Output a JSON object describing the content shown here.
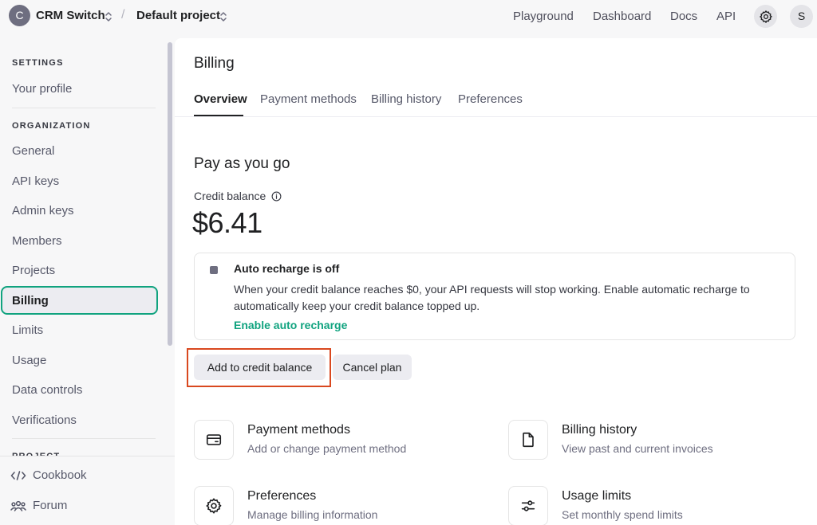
{
  "topbar": {
    "org_initial": "C",
    "org_name": "CRM Switch",
    "separator": "/",
    "project_name": "Default project",
    "nav": [
      "Playground",
      "Dashboard",
      "Docs",
      "API"
    ],
    "user_initial": "S"
  },
  "sidebar": {
    "settings_heading": "SETTINGS",
    "your_profile": "Your profile",
    "organization_heading": "ORGANIZATION",
    "items": [
      "General",
      "API keys",
      "Admin keys",
      "Members",
      "Projects",
      "Billing",
      "Limits",
      "Usage",
      "Data controls",
      "Verifications"
    ],
    "active_item": "Billing",
    "project_heading": "PROJECT",
    "footer": [
      "Cookbook",
      "Forum"
    ]
  },
  "main": {
    "title": "Billing",
    "tabs": [
      "Overview",
      "Payment methods",
      "Billing history",
      "Preferences"
    ],
    "active_tab": "Overview",
    "section_title": "Pay as you go",
    "credit_label": "Credit balance",
    "credit_value": "$6.41",
    "recharge": {
      "title": "Auto recharge is off",
      "description": "When your credit balance reaches $0, your API requests will stop working. Enable automatic recharge to automatically keep your credit balance topped up.",
      "link": "Enable auto recharge"
    },
    "buttons": {
      "add_credit": "Add to credit balance",
      "cancel_plan": "Cancel plan"
    },
    "cards": [
      {
        "icon": "credit-card-icon",
        "title": "Payment methods",
        "subtitle": "Add or change payment method"
      },
      {
        "icon": "document-icon",
        "title": "Billing history",
        "subtitle": "View past and current invoices"
      },
      {
        "icon": "gear-icon",
        "title": "Preferences",
        "subtitle": "Manage billing information"
      },
      {
        "icon": "sliders-icon",
        "title": "Usage limits",
        "subtitle": "Set monthly spend limits"
      }
    ]
  },
  "colors": {
    "accent": "#10a37f",
    "highlight_outline": "#d9481f",
    "background": "#f7f7f8"
  }
}
